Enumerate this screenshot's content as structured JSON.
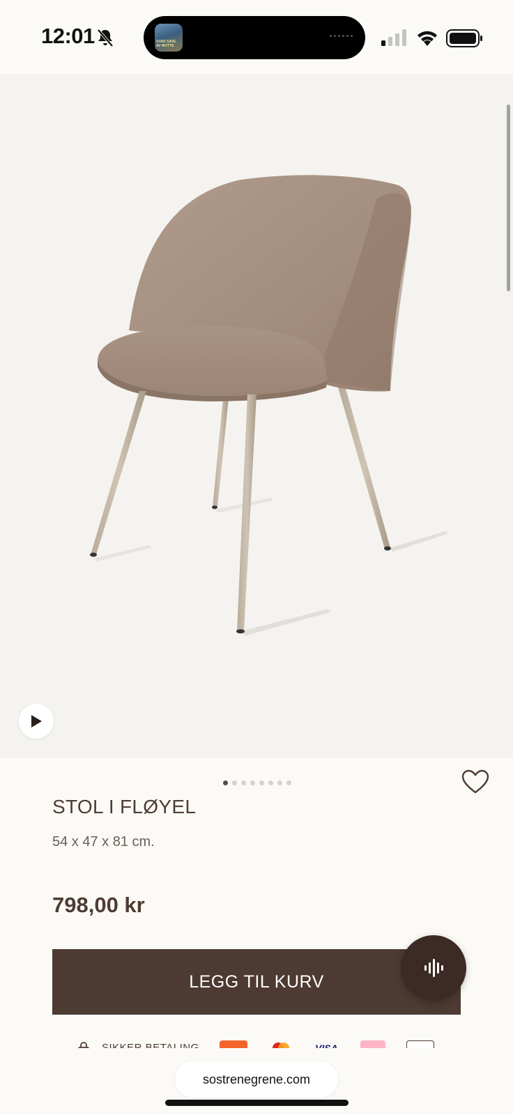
{
  "status_bar": {
    "time": "12:01",
    "island_art_text": "SVAR SAVE\nAV MOTTE"
  },
  "product": {
    "title": "STOL I FLØYEL",
    "dimensions": "54 x 47 x 81 cm.",
    "price": "798,00 kr",
    "image_count": 8,
    "active_image_index": 0,
    "color": "#a58f80"
  },
  "actions": {
    "add_to_cart_label": "LEGG TIL KURV"
  },
  "payment": {
    "secure_label": "SIKKER BETALING",
    "methods": [
      "klarna-style-orange",
      "mastercard",
      "visa",
      "klarna",
      "other-card"
    ]
  },
  "browser": {
    "url": "sostrenegrene.com"
  },
  "colors": {
    "brand_brown": "#4d3a32",
    "text_brown": "#4e3c34",
    "background": "#fbfaf6"
  }
}
